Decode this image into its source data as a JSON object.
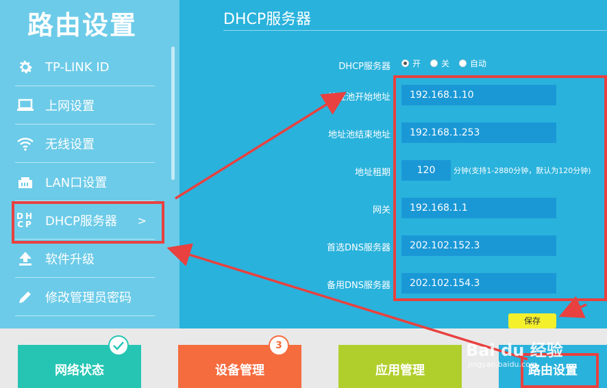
{
  "sidebar": {
    "title": "路由设置",
    "items": [
      {
        "label": "TP-LINK ID",
        "icon": "gear-icon"
      },
      {
        "label": "上网设置",
        "icon": "laptop-icon"
      },
      {
        "label": "无线设置",
        "icon": "wifi-icon"
      },
      {
        "label": "LAN口设置",
        "icon": "lan-port-icon"
      },
      {
        "label": "DHCP服务器",
        "icon": "dhcp-icon",
        "icon_text": "DHCP",
        "chevron": ">"
      },
      {
        "label": "软件升级",
        "icon": "upload-icon"
      },
      {
        "label": "修改管理员密码",
        "icon": "pencil-icon"
      }
    ]
  },
  "main": {
    "title": "DHCP服务器",
    "dhcp_label": "DHCP服务器",
    "dhcp_options": [
      "开",
      "关",
      "自动"
    ],
    "dhcp_selected": "开",
    "fields": {
      "pool_start": {
        "label": "地址池开始地址",
        "value": "192.168.1.10"
      },
      "pool_end": {
        "label": "地址池结束地址",
        "value": "192.168.1.253"
      },
      "lease": {
        "label": "地址租期",
        "value": "120",
        "hint": "分钟(支持1-2880分钟，默认为120分钟)"
      },
      "gateway": {
        "label": "网关",
        "value": "192.168.1.1"
      },
      "dns_primary": {
        "label": "首选DNS服务器",
        "value": "202.102.152.3"
      },
      "dns_secondary": {
        "label": "备用DNS服务器",
        "value": "202.102.154.3"
      }
    },
    "save_label": "保存"
  },
  "bottom_nav": {
    "network_status": {
      "label": "网络状态",
      "color": "#26c5b3",
      "badge_icon": "check-icon"
    },
    "device_mgmt": {
      "label": "设备管理",
      "color": "#f56c3f",
      "badge": "3"
    },
    "app_mgmt": {
      "label": "应用管理",
      "color": "#b0cf2c"
    },
    "router_settings": {
      "label": "路由设置",
      "color": "#29b2dc"
    }
  },
  "watermark": {
    "text": "Bai du 经验",
    "sub": "jingyan.baidu.com"
  },
  "colors": {
    "accent_red": "#e8413f",
    "sidebar_bg": "#6ccbe8",
    "main_bg": "#29b2dc",
    "field_bg": "#1a98d6",
    "save_bg": "#f4f02c"
  }
}
